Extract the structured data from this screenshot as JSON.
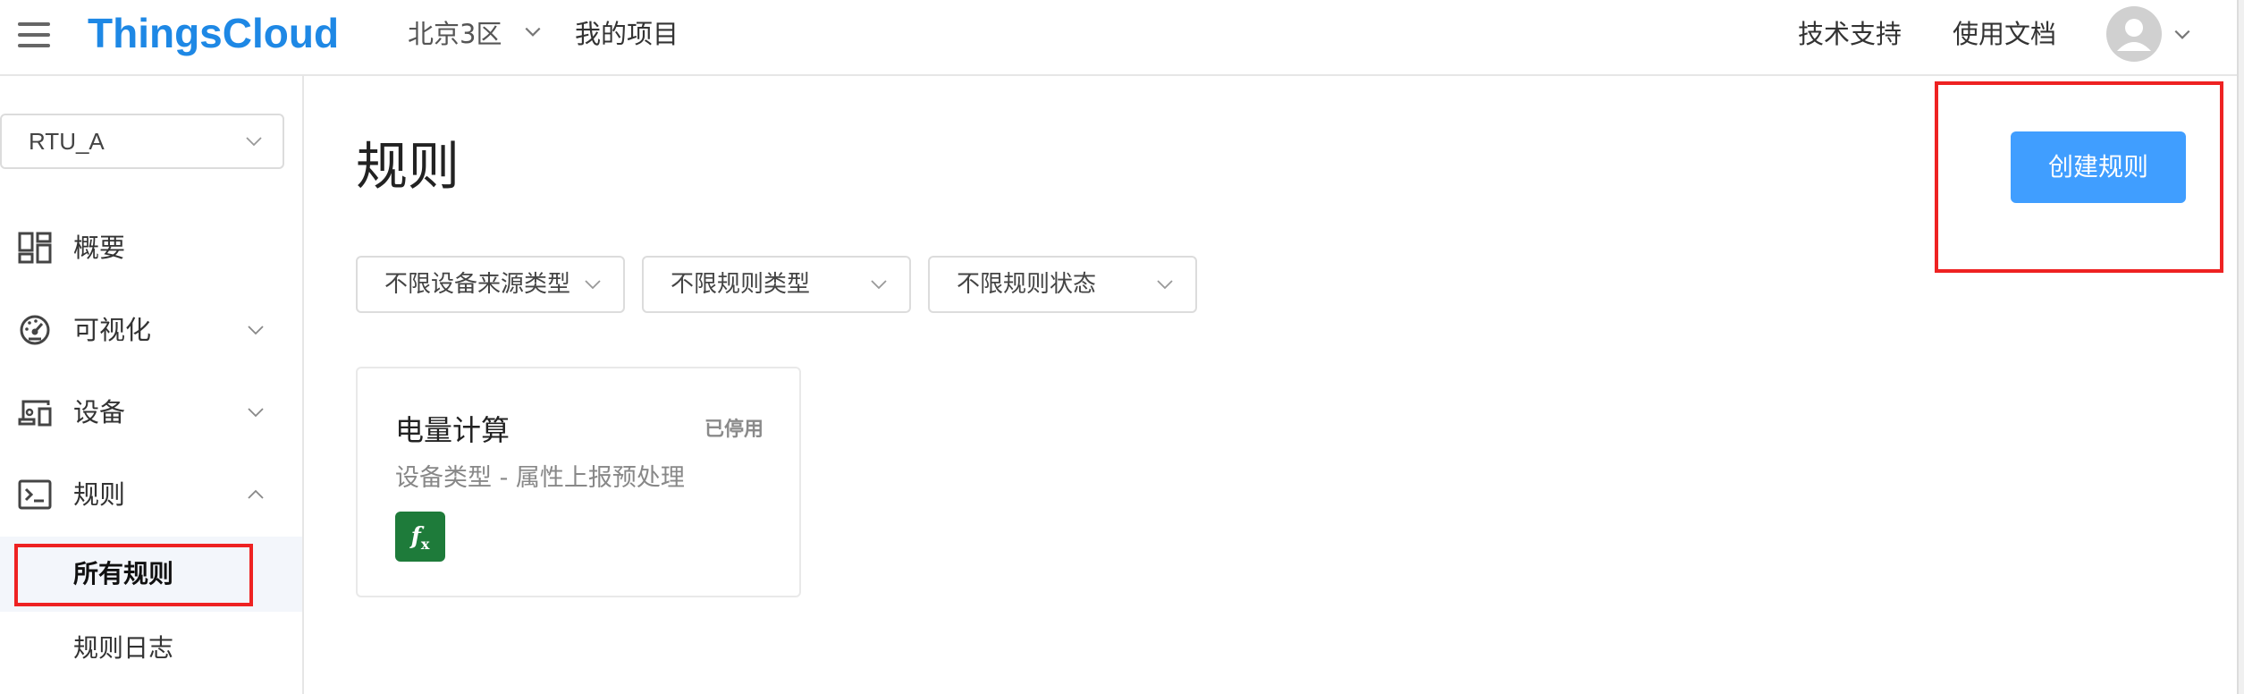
{
  "header": {
    "logo": "ThingsCloud",
    "region": "北京3区",
    "my_projects": "我的项目",
    "tech_support": "技术支持",
    "docs": "使用文档"
  },
  "sidebar": {
    "project_select": "RTU_A",
    "items": [
      {
        "label": "概要",
        "icon": "dashboard-icon"
      },
      {
        "label": "可视化",
        "icon": "gauge-icon"
      },
      {
        "label": "设备",
        "icon": "devices-icon"
      },
      {
        "label": "规则",
        "icon": "terminal-icon"
      }
    ],
    "sub_items": [
      {
        "label": "所有规则",
        "active": true
      },
      {
        "label": "规则日志",
        "active": false
      }
    ]
  },
  "main": {
    "title": "规则",
    "create_button": "创建规则",
    "filters": [
      "不限设备来源类型",
      "不限规则类型",
      "不限规则状态"
    ],
    "rules": [
      {
        "title": "电量计算",
        "status": "已停用",
        "subtitle": "设备类型 - 属性上报预处理",
        "icon_label": "fx",
        "icon_color": "#1e7b3a"
      }
    ]
  },
  "colors": {
    "brand": "#1e88e5",
    "primary_button": "#409eff",
    "highlight_box": "#ee2222"
  }
}
